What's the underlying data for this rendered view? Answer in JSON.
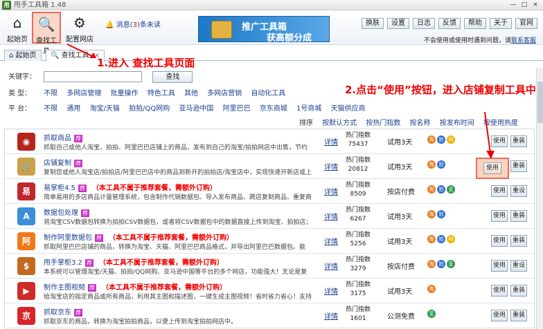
{
  "app": {
    "logo": "用",
    "title": "甩手工具箱 1.48"
  },
  "window": {
    "minimize": "—",
    "maximize": "□",
    "close": "×"
  },
  "toolbar": {
    "home": "起始页",
    "find": "查找工具",
    "config": "配置网店"
  },
  "message": {
    "prefix": "消息(",
    "count": "3",
    "suffix": ")条未读"
  },
  "banner": {
    "line1": "推广工具箱",
    "line2": "获高额分成"
  },
  "menu": [
    "换肤",
    "设置",
    "日志",
    "反馈",
    "帮助",
    "关于",
    "官网"
  ],
  "hint": {
    "text": "不会使用或使用时遇到问题，请",
    "link": "联系客服"
  },
  "tabs": [
    {
      "label": "起始页"
    },
    {
      "label": "查找工具"
    }
  ],
  "annotations": {
    "step1": "1.进入 查找工具页面",
    "step2": "2.点击“使用”按钮，进入店铺复制工具中"
  },
  "filters": {
    "keyword_label": "关键字：",
    "search_button": "查找",
    "type_label": "类  型：",
    "type_options": [
      "不限",
      "多网店管理",
      "批量操作",
      "特色工具",
      "其他",
      "多网店营销",
      "自动化工具"
    ],
    "platform_label": "平  台：",
    "platform_options": [
      "不限",
      "通用",
      "淘宝/天猫",
      "拍拍/QQ网购",
      "亚马逊中国",
      "阿里巴巴",
      "京东商城",
      "1号商城",
      "天猫供应商"
    ]
  },
  "sort": {
    "label": "排序",
    "options": [
      "按默认方式",
      "按热门指数",
      "按名称",
      "按发布时间",
      "按使用热度"
    ]
  },
  "rows": [
    {
      "name": "抓取商品",
      "tag": "荐",
      "note": "",
      "desc": "抓取自己或他人淘宝、拍拍、阿里巴巴店铺上的商品，发布到自己的淘宝/拍拍网店中出售，节约",
      "detail": "详情",
      "hot_label": "热门指数",
      "hot": "75437",
      "trial": "试用3天",
      "use": "使用",
      "reinstall": "重装"
    },
    {
      "name": "店铺复制",
      "tag": "荐",
      "note": "",
      "desc": "复制您或他人淘宝店/拍拍店/阿里巴巴店中的商品到新开的拍拍店/淘宝店中，实现快速开新店或上",
      "detail": "详情",
      "hot_label": "热门指数",
      "hot": "20812",
      "trial": "试用3天",
      "use": "使用",
      "reinstall": "重装"
    },
    {
      "name": "易掌柜4.5",
      "tag": "荐",
      "note": "（本工具不属于推荐套餐，需额外订购）",
      "desc": "简单易用的多店商品计量管理系统，包含制作代销数据包、导入发布商品、跨店复制商品、重复商",
      "detail": "详情",
      "hot_label": "热门指数",
      "hot": "8509",
      "trial": "按店付费",
      "use": "使用",
      "reinstall": "重设"
    },
    {
      "name": "数据包处理",
      "tag": "荐",
      "note": "",
      "desc": "将淘宝CSV数据包转换为拍拍CSV数据包，或者将CSV数据包中的数据直接上传到淘宝、拍拍店；",
      "detail": "详情",
      "hot_label": "热门指数",
      "hot": "6267",
      "trial": "试用3天",
      "use": "使用",
      "reinstall": "重装"
    },
    {
      "name": "制作阿里数据包",
      "tag": "荐",
      "note": "（本工具不属于推荐套餐，需额外订购）",
      "desc": "抓取阿里巴巴店铺的商品，转换为淘宝、天猫、阿里巴巴商品格式，并导出阿里巴巴数据包。能",
      "detail": "详情",
      "hot_label": "热门指数",
      "hot": "5256",
      "trial": "试用3天",
      "use": "使用",
      "reinstall": "重装"
    },
    {
      "name": "甩手掌柜3.2",
      "tag": "荐",
      "note": "（本工具不属于推荐套餐，需额外订购）",
      "desc": "本系统可以管理淘宝/天猫、拍拍/QQ网购、亚马逊中国等平台的多个网店，功能强大！无论是复",
      "detail": "详情",
      "hot_label": "热门指数",
      "hot": "3279",
      "trial": "按店付费",
      "use": "使用",
      "reinstall": "重设"
    },
    {
      "name": "制作主图视频",
      "tag": "荐",
      "note": "（本工具不属于推荐套餐，需额外订购）",
      "desc": "给淘宝店的指定商品或所有商品，利用其主图和描述图，一键生成主图视频！省时省力省心！支持",
      "detail": "详情",
      "hot_label": "热门指数",
      "hot": "3175",
      "trial": "试用3天",
      "use": "使用",
      "reinstall": "重装"
    },
    {
      "name": "抓取京东",
      "tag": "荐",
      "note": "",
      "desc": "抓取京东的商品，转换为淘宝拍拍商品，以便上传到淘宝拍拍网店中。",
      "detail": "详情",
      "hot_label": "热门指数",
      "hot": "1601",
      "trial": "公测免费",
      "use": "使用",
      "reinstall": "重装"
    }
  ]
}
